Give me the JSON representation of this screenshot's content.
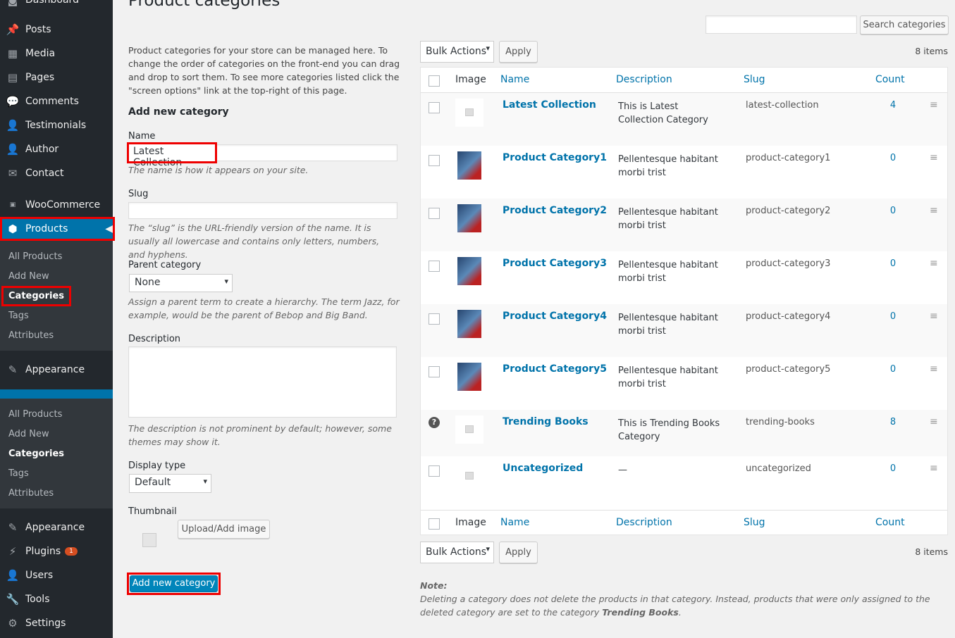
{
  "sidebar": {
    "top_item": "Dashboard",
    "items": [
      {
        "label": "Posts",
        "icon": "pin-icon"
      },
      {
        "label": "Media",
        "icon": "media-icon"
      },
      {
        "label": "Pages",
        "icon": "pages-icon"
      },
      {
        "label": "Comments",
        "icon": "comment-icon"
      },
      {
        "label": "Testimonials",
        "icon": "user-icon"
      },
      {
        "label": "Author",
        "icon": "user-icon"
      },
      {
        "label": "Contact",
        "icon": "mail-icon"
      }
    ],
    "woocommerce": "WooCommerce",
    "products": "Products",
    "submenu": [
      "All Products",
      "Add New",
      "Categories",
      "Tags",
      "Attributes"
    ],
    "appearance": "Appearance",
    "plugins": "Plugins",
    "plugins_badge": "1",
    "users": "Users",
    "tools": "Tools",
    "settings": "Settings"
  },
  "page": {
    "title": "Product categories",
    "intro": "Product categories for your store can be managed here. To change the order of categories on the front-end you can drag and drop to sort them. To see more categories listed click the \"screen options\" link at the top-right of this page.",
    "add_heading": "Add new category",
    "name_label": "Name",
    "name_value": "Latest Collection",
    "name_help": "The name is how it appears on your site.",
    "slug_label": "Slug",
    "slug_value": "",
    "slug_help": "The “slug” is the URL-friendly version of the name. It is usually all lowercase and contains only letters, numbers, and hyphens.",
    "parent_label": "Parent category",
    "parent_value": "None",
    "parent_help": "Assign a parent term to create a hierarchy. The term Jazz, for example, would be the parent of Bebop and Big Band.",
    "desc_label": "Description",
    "desc_help": "The description is not prominent by default; however, some themes may show it.",
    "display_label": "Display type",
    "display_value": "Default",
    "thumb_label": "Thumbnail",
    "upload_btn": "Upload/Add image",
    "submit_btn": "Add new category"
  },
  "table": {
    "search_btn": "Search categories",
    "search_value": "",
    "bulk": "Bulk Actions",
    "apply": "Apply",
    "items": "8 items",
    "headers": [
      "Image",
      "Name",
      "Description",
      "Slug",
      "Count"
    ],
    "rows": [
      {
        "name": "Latest Collection",
        "desc": "This is Latest Collection Category",
        "slug": "latest-collection",
        "count": "4",
        "image": "placeholder"
      },
      {
        "name": "Product Category1",
        "desc": "Pellentesque habitant morbi trist",
        "slug": "product-category1",
        "count": "0",
        "image": "book"
      },
      {
        "name": "Product Category2",
        "desc": "Pellentesque habitant morbi trist",
        "slug": "product-category2",
        "count": "0",
        "image": "book"
      },
      {
        "name": "Product Category3",
        "desc": "Pellentesque habitant morbi trist",
        "slug": "product-category3",
        "count": "0",
        "image": "book"
      },
      {
        "name": "Product Category4",
        "desc": "Pellentesque habitant morbi trist",
        "slug": "product-category4",
        "count": "0",
        "image": "book"
      },
      {
        "name": "Product Category5",
        "desc": "Pellentesque habitant morbi trist",
        "slug": "product-category5",
        "count": "0",
        "image": "book"
      },
      {
        "name": "Trending Books",
        "desc": "This is Trending Books Category",
        "slug": "trending-books",
        "count": "8",
        "image": "placeholder"
      },
      {
        "name": "Uncategorized",
        "desc": "—",
        "slug": "uncategorized",
        "count": "0",
        "image": "placeholder"
      }
    ],
    "note_title": "Note:",
    "note_text": "Deleting a category does not delete the products in that category. Instead, products that were only assigned to the deleted category are set to the category ",
    "note_bold": "Trending Books",
    "note_end": "."
  }
}
